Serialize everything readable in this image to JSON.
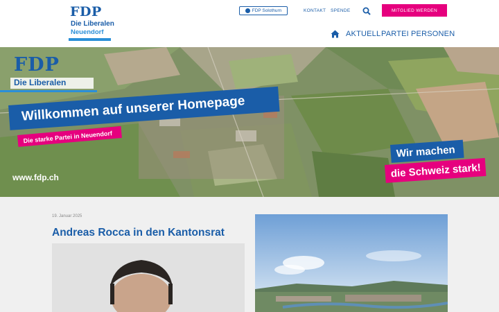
{
  "brand": {
    "logo_main": "FDP",
    "logo_sub": "Die Liberalen",
    "logo_town": "Neuendorf",
    "primary_color": "#1a5da8",
    "accent_color": "#e6007e",
    "light_blue": "#2a8fd8"
  },
  "topbar": {
    "region_link": "FDP Solothurn",
    "region_icon": "globe-icon",
    "links": [
      "KONTAKT",
      "SPENDE"
    ],
    "search_icon": "search-icon",
    "member_button": "MITGLIED WERDEN"
  },
  "nav": {
    "home_icon": "home-icon",
    "items": [
      "AKTUELL",
      "PARTEI",
      "PERSONEN"
    ]
  },
  "hero": {
    "logo_main": "FDP",
    "logo_sub": "Die Liberalen",
    "headline": "Willkommen auf unserer Homepage",
    "subline": "Die starke Partei in Neuendorf",
    "slogan_line1": "Wir machen",
    "slogan_line2": "die Schweiz stark!",
    "url": "www.fdp.ch"
  },
  "news": {
    "date": "19. Januar 2025",
    "title": "Andreas Rocca in den Kantonsrat"
  }
}
